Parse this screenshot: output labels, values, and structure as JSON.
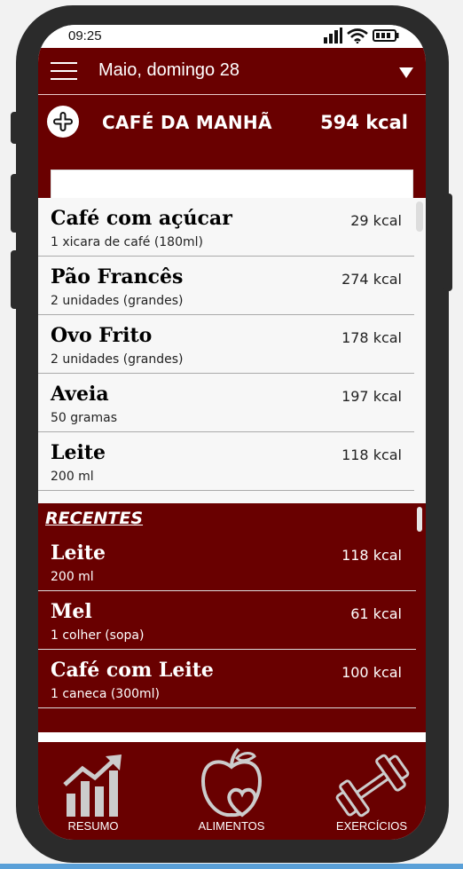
{
  "status": {
    "time": "09:25"
  },
  "header": {
    "date": "Maio, domingo 28",
    "meal_title": "CAFÉ DA MANHÃ",
    "meal_kcal": "594 kcal",
    "search_value": ""
  },
  "foods": [
    {
      "name": "Café com açúcar",
      "portion": "1 xicara de café (180ml)",
      "kcal": "29 kcal"
    },
    {
      "name": "Pão Francês",
      "portion": "2 unidades (grandes)",
      "kcal": "274 kcal"
    },
    {
      "name": "Ovo Frito",
      "portion": "2 unidades (grandes)",
      "kcal": "178 kcal"
    },
    {
      "name": "Aveia",
      "portion": "50 gramas",
      "kcal": "197 kcal"
    },
    {
      "name": "Leite",
      "portion": "200 ml",
      "kcal": "118 kcal"
    }
  ],
  "recent": {
    "title": "RECENTES",
    "items": [
      {
        "name": "Leite",
        "portion": "200 ml",
        "kcal": "118 kcal"
      },
      {
        "name": "Mel",
        "portion": "1 colher (sopa)",
        "kcal": "61 kcal"
      },
      {
        "name": "Café com Leite",
        "portion": "1 caneca (300ml)",
        "kcal": "100 kcal"
      }
    ]
  },
  "nav": {
    "items": [
      {
        "label": "RESUMO",
        "icon": "bar-chart-icon"
      },
      {
        "label": "ALIMENTOS",
        "icon": "apple-icon"
      },
      {
        "label": "EXERCÍCIOS",
        "icon": "dumbbell-icon"
      }
    ]
  },
  "colors": {
    "primary": "#690000",
    "accent_line": "#5aa0d8"
  }
}
